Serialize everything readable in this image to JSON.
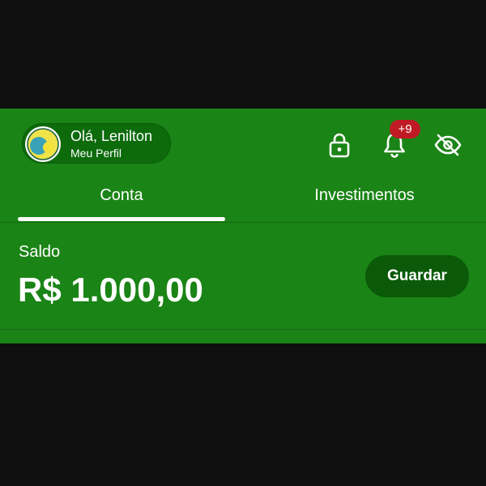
{
  "profile": {
    "greeting": "Olá, Lenilton",
    "subtitle": "Meu Perfil",
    "avatar_icon": "avatar-icon"
  },
  "header_actions": {
    "lock_icon": "lock-icon",
    "bell_icon": "bell-icon",
    "notification_badge": "+9",
    "visibility_icon": "eye-off-icon"
  },
  "tabs": [
    {
      "label": "Conta",
      "active": true
    },
    {
      "label": "Investimentos",
      "active": false
    }
  ],
  "balance": {
    "label": "Saldo",
    "value": "R$ 1.000,00",
    "action_label": "Guardar"
  },
  "colors": {
    "panel_background": "#1b8416",
    "dark_green": "#0a5a09",
    "badge_red": "#c01a24",
    "screen_background": "#0f0f0f"
  }
}
